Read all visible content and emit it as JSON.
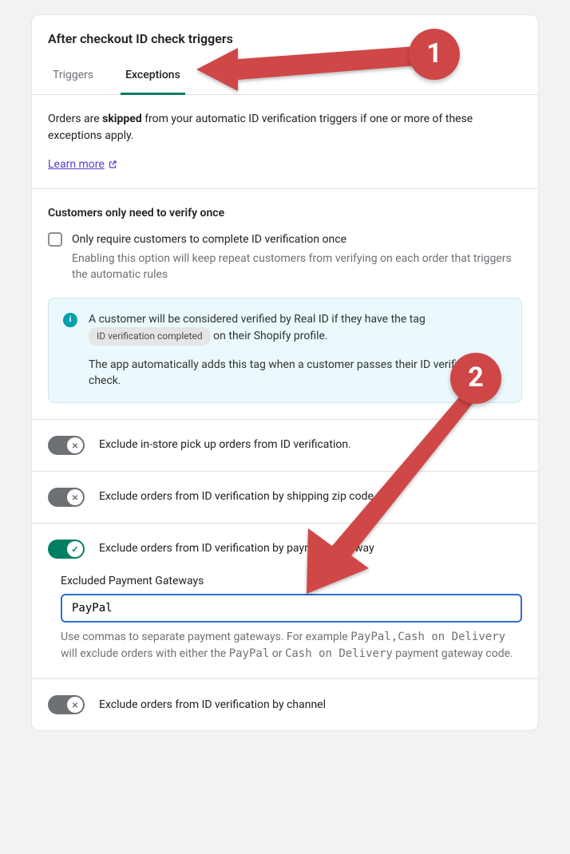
{
  "header": {
    "title": "After checkout ID check triggers"
  },
  "tabs": {
    "triggers": "Triggers",
    "exceptions": "Exceptions"
  },
  "intro": {
    "prefix": "Orders are ",
    "bold": "skipped",
    "suffix": " from your automatic ID verification triggers if one or more of these exceptions apply.",
    "learn_more": "Learn more "
  },
  "verify_once": {
    "heading": "Customers only need to verify once",
    "checkbox_label": "Only require customers to complete ID verification once",
    "help": "Enabling this option will keep repeat customers from verifying on each order that triggers the automatic rules"
  },
  "info": {
    "line1_prefix": "A customer will be considered verified by Real ID if they have the tag ",
    "tag": "ID verification completed",
    "line1_suffix": " on their Shopify profile.",
    "line2": "The app automatically adds this tag when a customer passes their ID verification check."
  },
  "toggles": {
    "pickup": "Exclude in-store pick up orders from ID verification.",
    "shipping": "Exclude orders from ID verification by shipping zip code",
    "payment": "Exclude orders from ID verification by payment gateway",
    "channel": "Exclude orders from ID verification by channel"
  },
  "payment_section": {
    "field_label": "Excluded Payment Gateways",
    "value": "PayPal",
    "help_prefix": "Use commas to separate payment gateways. For example ",
    "help_code1": "PayPal,Cash on Delivery",
    "help_mid": " will exclude orders with either the ",
    "help_code2": "PayPal",
    "help_or": " or ",
    "help_code3": "Cash on Delivery",
    "help_suffix": " payment gateway code."
  },
  "annotations": {
    "badge1": "1",
    "badge2": "2"
  }
}
